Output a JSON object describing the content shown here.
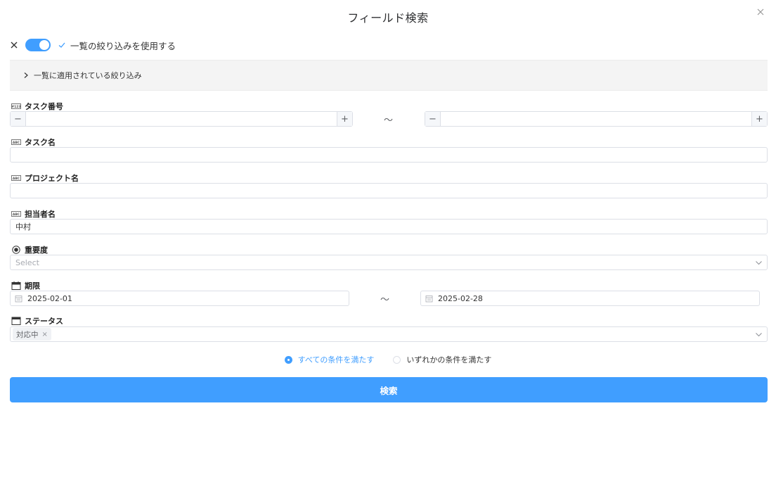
{
  "dialog": {
    "title": "フィールド検索"
  },
  "filter_toggle": {
    "label": "一覧の絞り込みを使用する",
    "enabled": true
  },
  "applied_filters": {
    "label": "一覧に適用されている絞り込み"
  },
  "fields": {
    "task_number": {
      "label": "タスク番号",
      "from": "",
      "to": "",
      "range_separator": "～",
      "minus": "−",
      "plus": "+"
    },
    "task_name": {
      "label": "タスク名",
      "value": ""
    },
    "project_name": {
      "label": "プロジェクト名",
      "value": ""
    },
    "assignee": {
      "label": "担当者名",
      "value": "中村"
    },
    "priority": {
      "label": "重要度",
      "placeholder": "Select"
    },
    "due_date": {
      "label": "期限",
      "from": "2025-02-01",
      "to": "2025-02-28",
      "range_separator": "～"
    },
    "status": {
      "label": "ステータス",
      "tags": [
        "対応中"
      ]
    }
  },
  "match_mode": {
    "options": [
      "すべての条件を満たす",
      "いずれかの条件を満たす"
    ],
    "selected": "すべての条件を満たす"
  },
  "search_button": {
    "label": "検索"
  },
  "colors": {
    "accent": "#409eff",
    "border": "#dcdfe6",
    "panel": "#f4f4f4"
  }
}
